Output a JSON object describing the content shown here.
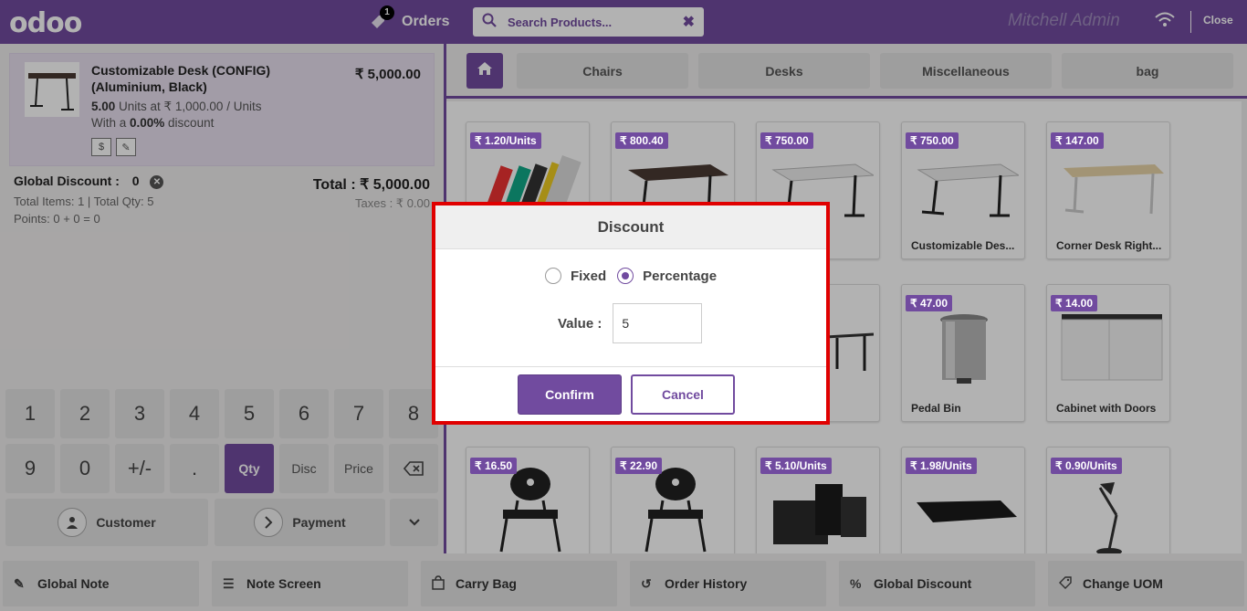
{
  "colors": {
    "brand": "#714b9f",
    "highlight": "#e00000"
  },
  "header": {
    "logo": "odoo",
    "orders_label": "Orders",
    "orders_badge": "1",
    "search_placeholder": "Search Products...",
    "user": "Mitchell Admin",
    "close_label": "Close"
  },
  "orderline": {
    "name": "Customizable Desk (CONFIG) (Aluminium, Black)",
    "price": "₹ 5,000.00",
    "qty": "5.00",
    "unit_text": " Units at ₹ 1,000.00 / Units",
    "discount_prefix": "With a ",
    "discount_value": "0.00%",
    "discount_suffix": " discount"
  },
  "summary": {
    "global_discount_label": "Global Discount :",
    "global_discount_value": "0",
    "total": "Total : ₹ 5,000.00",
    "taxes": "Taxes : ₹ 0.00",
    "items": "Total Items: 1  |  Total Qty: 5",
    "points": "Points: 0 + 0 = 0"
  },
  "numpad": {
    "row1": [
      "1",
      "2",
      "3",
      "4",
      "5",
      "6",
      "7",
      "8"
    ],
    "row2": [
      "9",
      "0",
      "+/-",
      ".",
      "Qty",
      "Disc",
      "Price"
    ],
    "customer": "Customer",
    "payment": "Payment"
  },
  "categories": [
    "Chairs",
    "Desks",
    "Miscellaneous",
    "bag"
  ],
  "products": [
    {
      "price": "₹ 1.20/Units",
      "name": ""
    },
    {
      "price": "₹ 800.40",
      "name": ""
    },
    {
      "price": "₹ 750.00",
      "name": "le Des..."
    },
    {
      "price": "₹ 750.00",
      "name": "Customizable Des..."
    },
    {
      "price": "₹ 147.00",
      "name": "Corner Desk Right..."
    },
    {
      "price": "₹ 47.00",
      "name": "Pedal Bin"
    },
    {
      "price": "₹ 14.00",
      "name": "Cabinet with Doors"
    },
    {
      "price": "₹ 16.50",
      "name": ""
    },
    {
      "price": "₹ 22.90",
      "name": ""
    },
    {
      "price": "₹ 5.10/Units",
      "name": ""
    },
    {
      "price": "₹ 1.98/Units",
      "name": ""
    },
    {
      "price": "₹ 0.90/Units",
      "name": ""
    }
  ],
  "bottom": [
    "Global Note",
    "Note Screen",
    "Carry Bag",
    "Order History",
    "Global Discount",
    "Change UOM"
  ],
  "dialog": {
    "title": "Discount",
    "option_fixed": "Fixed",
    "option_percentage": "Percentage",
    "selected": "Percentage",
    "value_label": "Value :",
    "value": "5",
    "confirm": "Confirm",
    "cancel": "Cancel"
  }
}
